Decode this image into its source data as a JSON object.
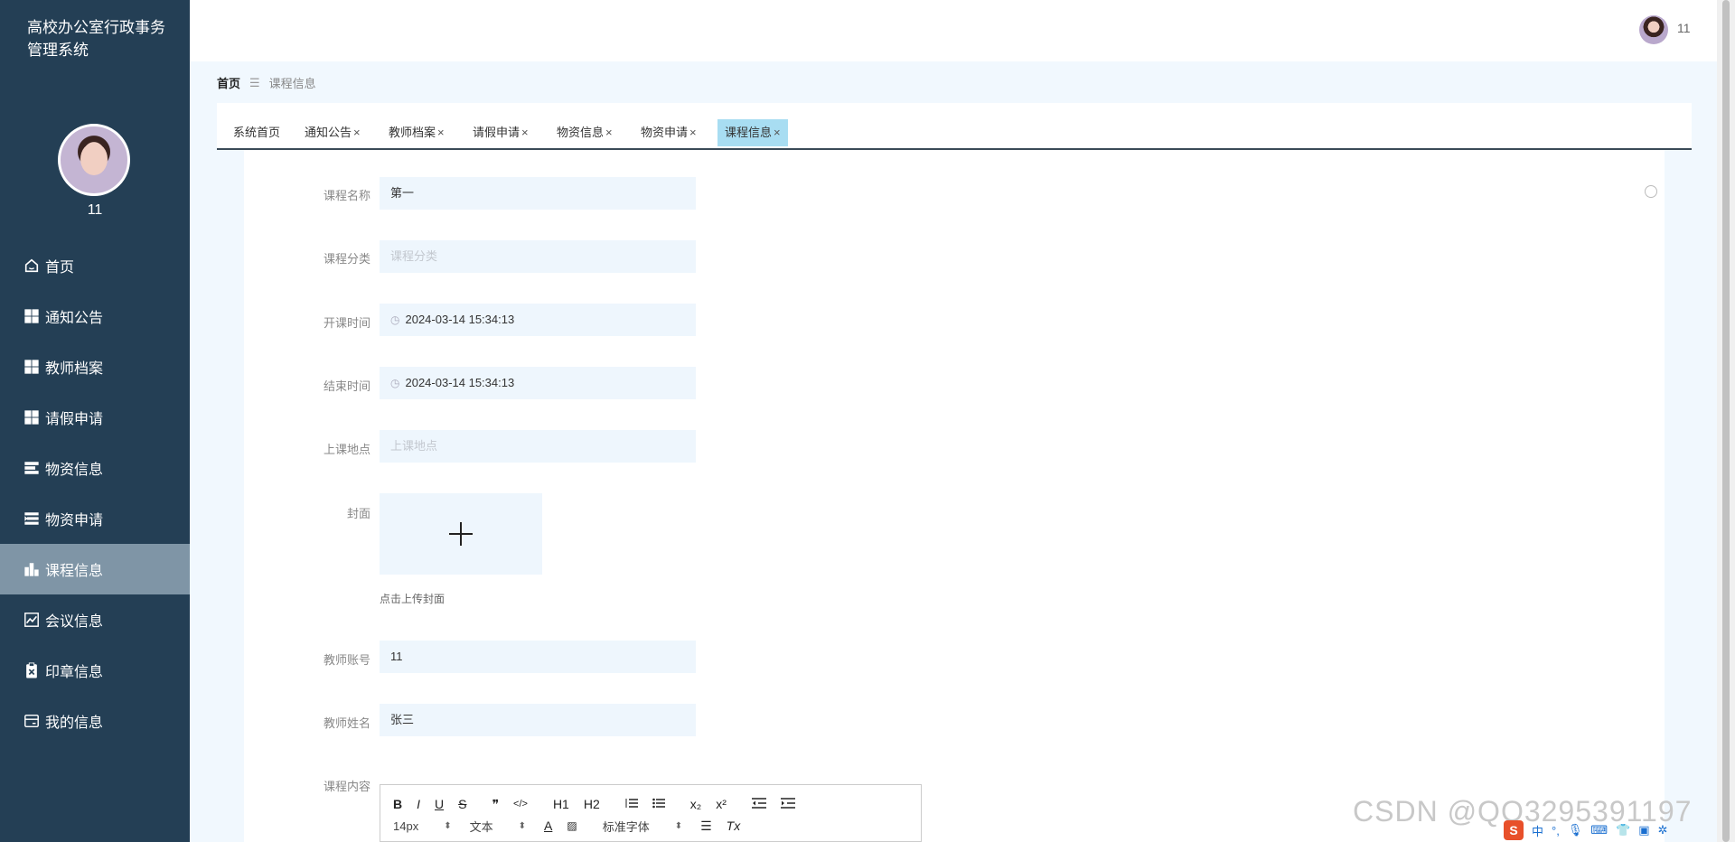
{
  "sidebar": {
    "brand": "高校办公室行政事务管理系统",
    "username": "11",
    "items": [
      {
        "label": "首页",
        "icon": "home-icon"
      },
      {
        "label": "通知公告",
        "icon": "grid-icon"
      },
      {
        "label": "教师档案",
        "icon": "grid-icon"
      },
      {
        "label": "请假申请",
        "icon": "grid-icon"
      },
      {
        "label": "物资信息",
        "icon": "list-icon"
      },
      {
        "label": "物资申请",
        "icon": "list-indent-icon"
      },
      {
        "label": "课程信息",
        "icon": "bar-chart-icon"
      },
      {
        "label": "会议信息",
        "icon": "line-chart-icon"
      },
      {
        "label": "印章信息",
        "icon": "clipboard-icon"
      },
      {
        "label": "我的信息",
        "icon": "card-icon"
      }
    ],
    "active_index": 6
  },
  "header": {
    "username": "11"
  },
  "breadcrumb": {
    "home": "首页",
    "separator": "☰",
    "current": "课程信息"
  },
  "tabs": [
    {
      "label": "系统首页",
      "closable": false
    },
    {
      "label": "通知公告",
      "closable": true
    },
    {
      "label": "教师档案",
      "closable": true
    },
    {
      "label": "请假申请",
      "closable": true
    },
    {
      "label": "物资信息",
      "closable": true
    },
    {
      "label": "物资申请",
      "closable": true
    },
    {
      "label": "课程信息",
      "closable": true
    }
  ],
  "form": {
    "course_name": {
      "label": "课程名称",
      "value": "第一",
      "placeholder": ""
    },
    "course_category": {
      "label": "课程分类",
      "value": "",
      "placeholder": "课程分类"
    },
    "start_time": {
      "label": "开课时间",
      "value": "2024-03-14 15:34:13"
    },
    "end_time": {
      "label": "结束时间",
      "value": "2024-03-14 15:34:13"
    },
    "location": {
      "label": "上课地点",
      "value": "",
      "placeholder": "上课地点"
    },
    "cover": {
      "label": "封面",
      "tip": "点击上传封面"
    },
    "teacher_account": {
      "label": "教师账号",
      "value": "11"
    },
    "teacher_name": {
      "label": "教师姓名",
      "value": "张三"
    },
    "course_content": {
      "label": "课程内容"
    }
  },
  "editor": {
    "row1": [
      "B",
      "I",
      "U",
      "S",
      "❞",
      "</>",
      "H1",
      "H2",
      "ol",
      "ul",
      "x₂",
      "x²",
      "outdent",
      "indent"
    ],
    "font_size": "14px",
    "text_type": "文本",
    "font_family": "标准字体"
  },
  "watermark": "CSDN @QQ3295391197",
  "ime": {
    "lang": "中"
  },
  "colors": {
    "sidebar_bg": "#243f55",
    "sidebar_active": "#7f95a6",
    "main_bg": "#f1f8fe",
    "input_bg": "#eef6fd",
    "tab_active": "#a8ddf2"
  }
}
